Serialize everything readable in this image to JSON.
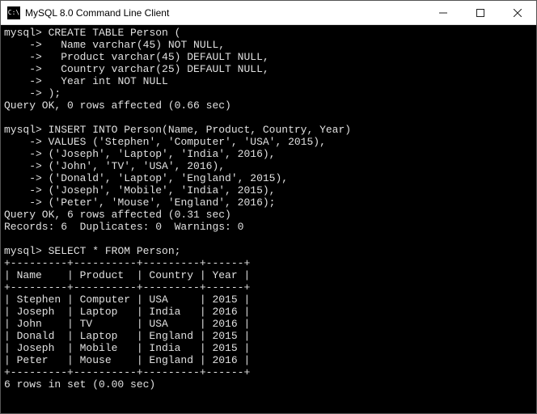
{
  "window": {
    "title": "MySQL 8.0 Command Line Client",
    "icon_label": "sql"
  },
  "terminal": {
    "prompt": "mysql>",
    "cont": "    ->",
    "create_table": {
      "header": "CREATE TABLE Person (",
      "col1": "  Name varchar(45) NOT NULL,",
      "col2": "  Product varchar(45) DEFAULT NULL,",
      "col3": "  Country varchar(25) DEFAULT NULL,",
      "col4": "  Year int NOT NULL",
      "close": ");",
      "result": "Query OK, 0 rows affected (0.66 sec)"
    },
    "insert": {
      "header": "INSERT INTO Person(Name, Product, Country, Year)",
      "v1": "VALUES ('Stephen', 'Computer', 'USA', 2015),",
      "v2": "('Joseph', 'Laptop', 'India', 2016),",
      "v3": "('John', 'TV', 'USA', 2016),",
      "v4": "('Donald', 'Laptop', 'England', 2015),",
      "v5": "('Joseph', 'Mobile', 'India', 2015),",
      "v6": "('Peter', 'Mouse', 'England', 2016);",
      "result1": "Query OK, 6 rows affected (0.31 sec)",
      "result2": "Records: 6  Duplicates: 0  Warnings: 0"
    },
    "select": {
      "query": "SELECT * FROM Person;",
      "sep": "+---------+----------+---------+------+",
      "header": "| Name    | Product  | Country | Year |",
      "rows": [
        "| Stephen | Computer | USA     | 2015 |",
        "| Joseph  | Laptop   | India   | 2016 |",
        "| John    | TV       | USA     | 2016 |",
        "| Donald  | Laptop   | England | 2015 |",
        "| Joseph  | Mobile   | India   | 2015 |",
        "| Peter   | Mouse    | England | 2016 |"
      ],
      "result": "6 rows in set (0.00 sec)"
    }
  },
  "chart_data": {
    "type": "table",
    "title": "Person",
    "columns": [
      "Name",
      "Product",
      "Country",
      "Year"
    ],
    "rows": [
      [
        "Stephen",
        "Computer",
        "USA",
        2015
      ],
      [
        "Joseph",
        "Laptop",
        "India",
        2016
      ],
      [
        "John",
        "TV",
        "USA",
        2016
      ],
      [
        "Donald",
        "Laptop",
        "England",
        2015
      ],
      [
        "Joseph",
        "Mobile",
        "India",
        2015
      ],
      [
        "Peter",
        "Mouse",
        "England",
        2016
      ]
    ]
  }
}
